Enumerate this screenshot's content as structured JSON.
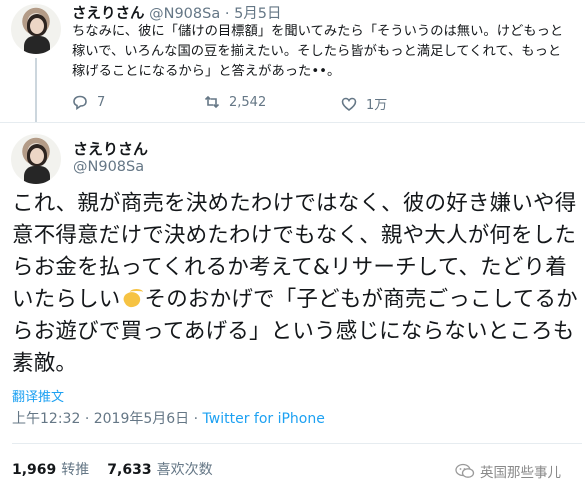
{
  "tweet1": {
    "name": "さえりさん",
    "handle": "@N908Sa",
    "dot": "·",
    "date": "5月5日",
    "text": "ちなみに、彼に「儲けの目標額」を聞いてみたら「そういうのは無い。けどもっと稼いで、いろんな国の豆を揃えたい。そしたら皆がもっと満足してくれて、もっと稼げることになるから」と答えがあった••。",
    "reply_count": "7",
    "retweet_count": "2,542",
    "like_count": "1万",
    "icons": [
      "reply-icon",
      "retweet-icon",
      "like-icon"
    ]
  },
  "tweet2": {
    "name": "さえりさん",
    "handle": "@N908Sa",
    "text_before_emoji": "これ、親が商売を決めたわけではなく、彼の好き嫌いや得意不得意だけで決めたわけでもなく、親や大人が何をしたらお金を払ってくれるか考えて&リサーチして、たどり着いたらしい",
    "emoji": "clapping-hands-icon",
    "text_after_emoji": "そのおかげで「子どもが商売ごっこしてるからお遊びで買ってあげる」という感じにならないところも素敵。",
    "translate_label": "翻译推文",
    "time": "上午12:32",
    "date": "2019年5月6日",
    "dot": "·",
    "source": "Twitter for iPhone",
    "retweets_num": "1,969",
    "retweets_label": "转推",
    "likes_num": "7,633",
    "likes_label": "喜欢次数"
  },
  "watermark": {
    "text": "英国那些事儿",
    "icon": "wechat-icon"
  },
  "colors": {
    "link": "#1da1f2",
    "secondary": "#657786",
    "text": "#14171a"
  }
}
